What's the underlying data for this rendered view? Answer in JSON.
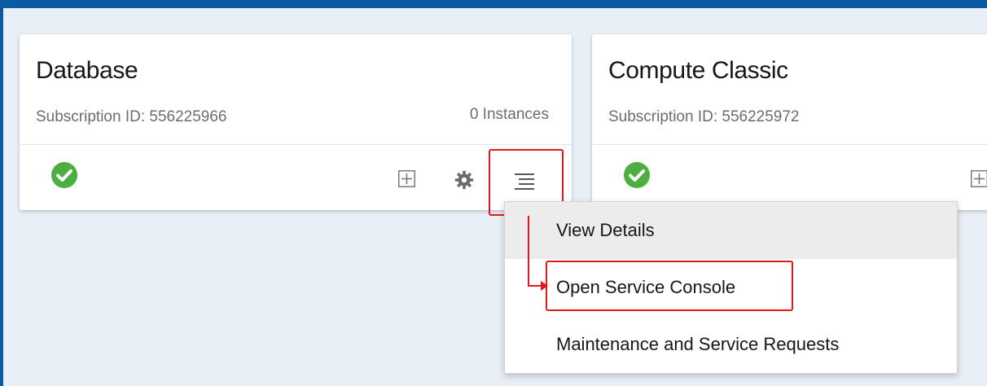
{
  "cards": [
    {
      "title": "Database",
      "subscription": "Subscription ID: 556225966",
      "instances": "0 Instances"
    },
    {
      "title": "Compute Classic",
      "subscription": "Subscription ID: 556225972"
    }
  ],
  "menu": {
    "items": [
      "View Details",
      "Open Service Console",
      "Maintenance and Service Requests"
    ]
  },
  "colors": {
    "top_bar": "#0b5aa6",
    "status_ok": "#4caf3f",
    "highlight": "#e01a1a"
  },
  "icons": {
    "status": "check-circle-icon",
    "add": "plus-square-icon",
    "settings": "gear-icon",
    "menu": "hamburger-menu-icon"
  }
}
